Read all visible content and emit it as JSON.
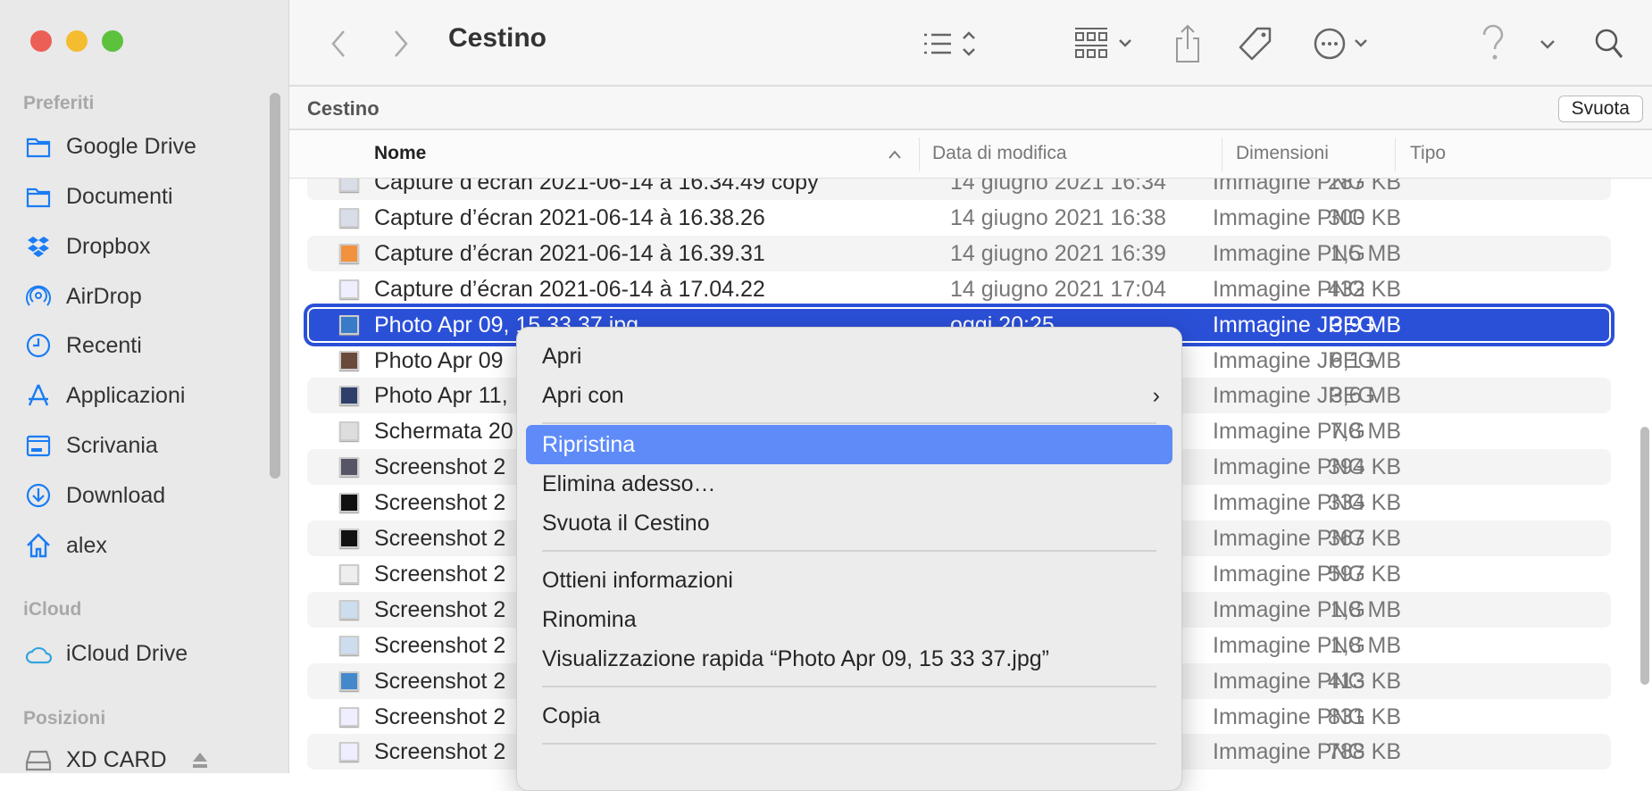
{
  "window": {
    "title": "Cestino",
    "traffic_lights": {
      "close": "#ec5f57",
      "minimize": "#f4bd2f",
      "zoom": "#5cc23e"
    }
  },
  "sidebar": {
    "sections": [
      {
        "label": "Preferiti",
        "items": [
          {
            "label": "Google Drive",
            "icon": "folder-icon"
          },
          {
            "label": "Documenti",
            "icon": "folder-icon"
          },
          {
            "label": "Dropbox",
            "icon": "dropbox-icon"
          },
          {
            "label": "AirDrop",
            "icon": "airdrop-icon"
          },
          {
            "label": "Recenti",
            "icon": "clock-icon"
          },
          {
            "label": "Applicazioni",
            "icon": "applications-icon"
          },
          {
            "label": "Scrivania",
            "icon": "desktop-icon"
          },
          {
            "label": "Download",
            "icon": "download-icon"
          },
          {
            "label": "alex",
            "icon": "home-icon"
          }
        ]
      },
      {
        "label": "iCloud",
        "items": [
          {
            "label": "iCloud Drive",
            "icon": "cloud-icon"
          }
        ]
      },
      {
        "label": "Posizioni",
        "items": [
          {
            "label": "XD CARD",
            "icon": "drive-icon"
          }
        ]
      }
    ],
    "accent": "#1a7cf5"
  },
  "toolbar": {
    "title": "Cestino",
    "icons": [
      "back-icon",
      "forward-icon",
      "list-view-icon",
      "group-icon",
      "share-icon",
      "tag-icon",
      "more-icon",
      "help-icon",
      "search-icon"
    ]
  },
  "pathbar": {
    "label": "Cestino",
    "empty_button": "Svuota"
  },
  "columns": {
    "name": "Nome",
    "date": "Data di modifica",
    "size": "Dimensioni",
    "kind": "Tipo"
  },
  "files": [
    {
      "name": "Capture d’écran 2021-06-14 à 16.34.49 copy",
      "date": "14 giugno 2021 16:34",
      "size": "287 KB",
      "kind": "Immagine PNG"
    },
    {
      "name": "Capture d’écran 2021-06-14 à 16.38.26",
      "date": "14 giugno 2021 16:38",
      "size": "300 KB",
      "kind": "Immagine PNG"
    },
    {
      "name": "Capture d’écran 2021-06-14 à 16.39.31",
      "date": "14 giugno 2021 16:39",
      "size": "1,5 MB",
      "kind": "Immagine PNG"
    },
    {
      "name": "Capture d’écran 2021-06-14 à 17.04.22",
      "date": "14 giugno 2021 17:04",
      "size": "432 KB",
      "kind": "Immagine PNG"
    },
    {
      "name": "Photo Apr 09, 15 33 37.jpg",
      "date": "oggi 20:25",
      "size": "3,9 MB",
      "kind": "Immagine JPEG",
      "selected": true
    },
    {
      "name": "Photo Apr 09",
      "date": "",
      "size": "6,1 MB",
      "kind": "Immagine JPEG"
    },
    {
      "name": "Photo Apr 11,",
      "date": "",
      "size": "3,6 MB",
      "kind": "Immagine JPEG"
    },
    {
      "name": "Schermata 20",
      "date": "",
      "size": "7,8 MB",
      "kind": "Immagine PNG"
    },
    {
      "name": "Screenshot 2",
      "date": "",
      "size": "394 KB",
      "kind": "Immagine PNG"
    },
    {
      "name": "Screenshot 2",
      "date": "",
      "size": "334 KB",
      "kind": "Immagine PNG"
    },
    {
      "name": "Screenshot 2",
      "date": "",
      "size": "367 KB",
      "kind": "Immagine PNG"
    },
    {
      "name": "Screenshot 2",
      "date": "",
      "size": "597 KB",
      "kind": "Immagine PNG"
    },
    {
      "name": "Screenshot 2",
      "date": "",
      "size": "1,8 MB",
      "kind": "Immagine PNG"
    },
    {
      "name": "Screenshot 2",
      "date": "",
      "size": "1,8 MB",
      "kind": "Immagine PNG"
    },
    {
      "name": "Screenshot 2",
      "date": "",
      "size": "413 KB",
      "kind": "Immagine PNG"
    },
    {
      "name": "Screenshot 2",
      "date": "",
      "size": "831 KB",
      "kind": "Immagine PNG"
    },
    {
      "name": "Screenshot 2",
      "date": "",
      "size": "788 KB",
      "kind": "Immagine PNG"
    }
  ],
  "context_menu": {
    "items": [
      {
        "label": "Apri"
      },
      {
        "label": "Apri con",
        "submenu": true
      },
      {
        "separator": true
      },
      {
        "label": "Ripristina",
        "highlighted": true
      },
      {
        "label": "Elimina adesso…"
      },
      {
        "label": "Svuota il Cestino"
      },
      {
        "separator": true
      },
      {
        "label": "Ottieni informazioni"
      },
      {
        "label": "Rinomina"
      },
      {
        "label": "Visualizzazione rapida “Photo Apr 09, 15 33 37.jpg”"
      },
      {
        "separator": true
      },
      {
        "label": "Copia"
      },
      {
        "separator": true
      }
    ],
    "highlight_color": "#5e8bf7"
  },
  "selection_color": "#2b50d8"
}
